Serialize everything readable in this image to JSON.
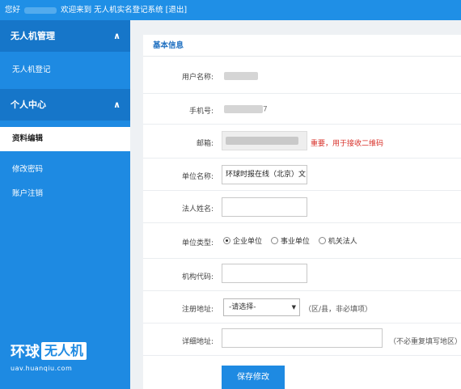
{
  "topbar": {
    "greeting": "您好",
    "welcome": "欢迎来到 无人机实名登记系统",
    "logout": "[退出]"
  },
  "sidebar": {
    "sections": [
      {
        "title": "无人机管理",
        "chevron": "∧",
        "items": [
          "无人机登记"
        ]
      },
      {
        "title": "个人中心",
        "chevron": "∧",
        "items": [
          "资料编辑",
          "修改密码",
          "账户注销"
        ]
      }
    ],
    "active_item": "资料编辑",
    "brand": {
      "name": "环球",
      "badge": "无人机",
      "url": "uav.huanqiu.com"
    }
  },
  "form": {
    "title": "基本信息",
    "fields": {
      "username": {
        "label": "用户名称:"
      },
      "phone": {
        "label": "手机号:",
        "visible_suffix": "7"
      },
      "email": {
        "label": "邮箱:",
        "note": "重要，用于接收二维码"
      },
      "company": {
        "label": "单位名称:",
        "value": "环球时报在线（北京）文"
      },
      "legal_name": {
        "label": "法人姓名:",
        "value": ""
      },
      "unit_type": {
        "label": "单位类型:",
        "options": [
          "企业单位",
          "事业单位",
          "机关法人"
        ],
        "selected": "企业单位"
      },
      "org_code": {
        "label": "机构代码:",
        "value": ""
      },
      "reg_address": {
        "label": "注册地址:",
        "selected": "-请选择-",
        "note": "（区/县，非必填项）"
      },
      "detail_address": {
        "label": "详细地址:",
        "value": "",
        "note": "（不必重复填写地区）"
      }
    },
    "save_label": "保存修改"
  },
  "colors": {
    "accent": "#1e8ae2",
    "accent_dark": "#1676c9",
    "warning": "#d8312a"
  }
}
